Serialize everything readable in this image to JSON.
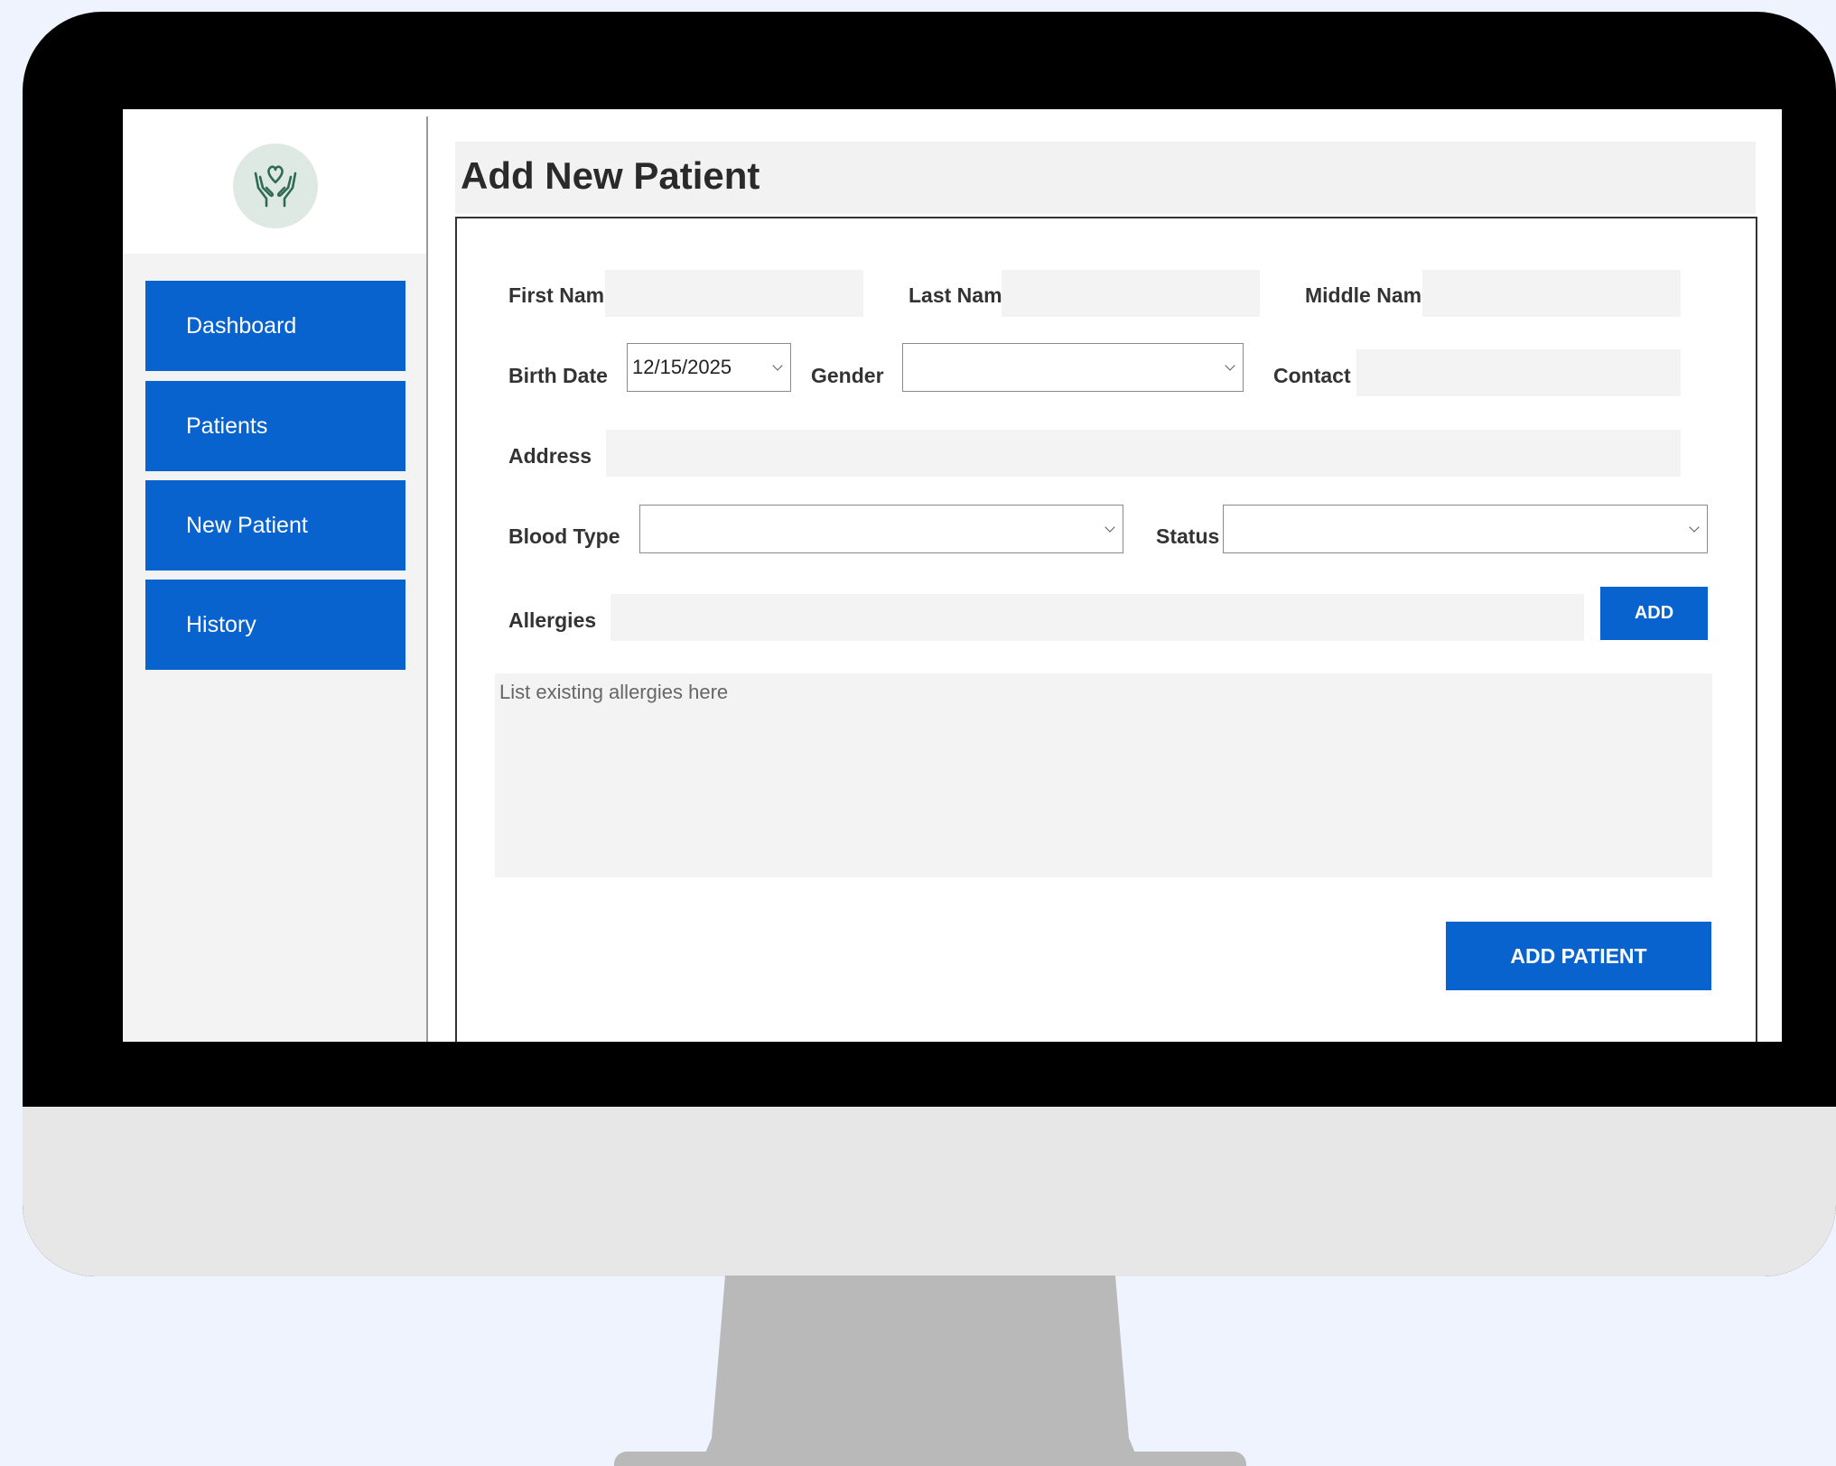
{
  "sidebar": {
    "logo_icon": "hands-heart-icon",
    "items": [
      {
        "label": "Dashboard"
      },
      {
        "label": "Patients"
      },
      {
        "label": "New Patient"
      },
      {
        "label": "History"
      }
    ]
  },
  "page": {
    "title": "Add New Patient"
  },
  "form": {
    "first_name_label": "First Name",
    "last_name_label": "Last Name",
    "middle_name_label": "Middle Name",
    "birth_date_label": "Birth Date",
    "birth_date_value": "12/15/2025",
    "gender_label": "Gender",
    "contact_label": "Contact",
    "address_label": "Address",
    "blood_type_label": "Blood Type",
    "status_label": "Status",
    "allergies_label": "Allergies",
    "add_allergy_button": "ADD",
    "allergy_list_placeholder": "List existing allergies here",
    "submit_button": "ADD PATIENT"
  },
  "colors": {
    "accent": "#0863cf",
    "field_bg": "#f3f3f3"
  }
}
